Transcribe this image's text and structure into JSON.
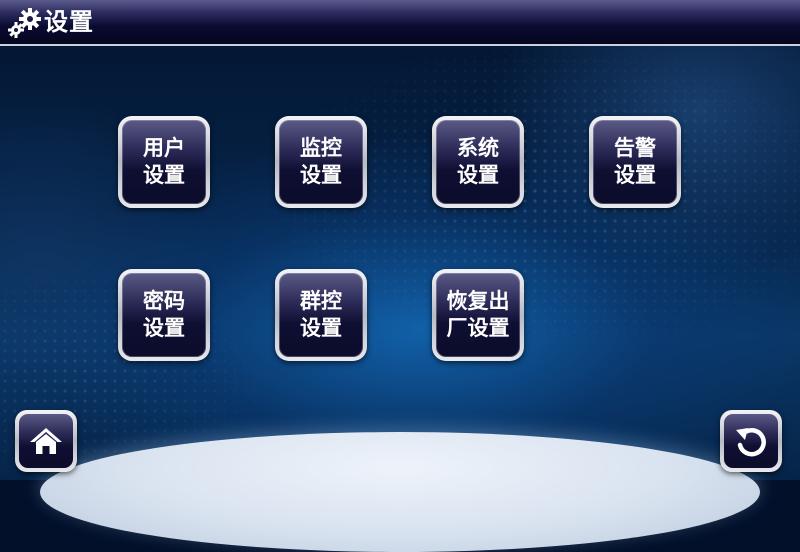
{
  "header": {
    "title": "设置",
    "icon": "gears-icon"
  },
  "tiles": [
    {
      "line1": "用户",
      "line2": "设置"
    },
    {
      "line1": "监控",
      "line2": "设置"
    },
    {
      "line1": "系统",
      "line2": "设置"
    },
    {
      "line1": "告警",
      "line2": "设置"
    },
    {
      "line1": "密码",
      "line2": "设置"
    },
    {
      "line1": "群控",
      "line2": "设置"
    },
    {
      "line1": "恢复出",
      "line2": "厂设置"
    }
  ],
  "nav": {
    "home_icon": "home-icon",
    "back_icon": "back-arrow-icon"
  },
  "colors": {
    "header_bg": "#05061e",
    "tile_face": "#0f0f33",
    "tile_frame": "#c8cad4",
    "text": "#ffffff"
  }
}
